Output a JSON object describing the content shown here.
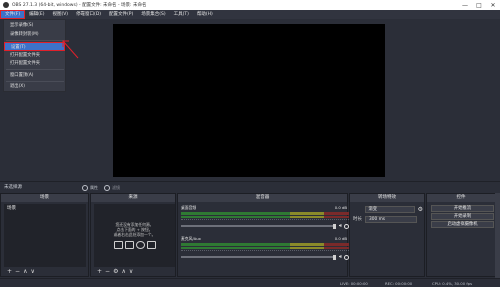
{
  "titlebar": {
    "title": "OBS 27.1.3 (64-bit, windows) - 配置文件: 未命名 - 场景: 未命名",
    "controls": [
      "—",
      "□",
      "✕"
    ]
  },
  "menubar": {
    "items": [
      "文件(F)",
      "编辑(E)",
      "视图(V)",
      "停靠窗口(D)",
      "配置文件(P)",
      "场景集合(S)",
      "工具(T)",
      "帮助(H)"
    ]
  },
  "file_menu": {
    "items": [
      "显示录像(S)",
      "录像转封装(M)",
      "设置(T)",
      "打开配置文件夹",
      "打开配置文件夹",
      "窗口置顶(A)",
      "退出(X)"
    ]
  },
  "scenebar": {
    "no_source": "未选择源",
    "properties": "属性",
    "filters": "滤镜"
  },
  "docks": {
    "scenes": {
      "title": "场景",
      "items": [
        "场景"
      ]
    },
    "sources": {
      "title": "来源",
      "hint_line1": "您还没有添加任何源。",
      "hint_line2": "点击下面的 + 按钮，",
      "hint_line3": "或者右击此处添加一个。"
    },
    "mixer": {
      "title": "混音器",
      "tracks": [
        {
          "name": "桌面音频",
          "db": "0.0 dB"
        },
        {
          "name": "麦克风/Aux",
          "db": "0.0 dB"
        }
      ]
    },
    "transitions": {
      "title": "转场特效",
      "type": "渐变",
      "duration_label": "时长",
      "duration": "300 ms"
    },
    "controls": {
      "title": "控件",
      "buttons": [
        "开始推流",
        "开始录制",
        "启动虚拟摄像机"
      ]
    }
  },
  "statusbar": {
    "live": "LIVE: 00:00:00",
    "rec": "REC: 00:00:00",
    "cpu": "CPU: 0.4%, 30.00 fps"
  },
  "colors": {
    "accent": "#3d72c9",
    "highlight_border": "#e0202a",
    "background": "#2b2e38"
  }
}
